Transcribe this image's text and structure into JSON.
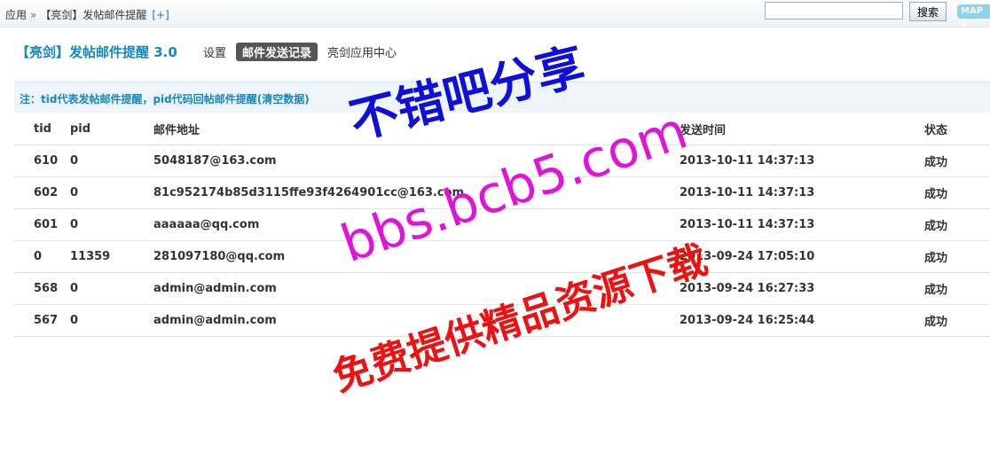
{
  "breadcrumb": {
    "app": "应用",
    "separator": "»",
    "plugin": "【亮剑】发帖邮件提醒",
    "add": "[+]"
  },
  "search": {
    "value": "",
    "button": "搜索"
  },
  "map_button": "MAP",
  "header": {
    "title": "【亮剑】发帖邮件提醒 3.0",
    "tabs": [
      {
        "label": "设置",
        "active": false
      },
      {
        "label": "邮件发送记录",
        "active": true
      },
      {
        "label": "亮剑应用中心",
        "active": false
      }
    ]
  },
  "note": "注：tid代表发帖邮件提醒，pid代码回帖邮件提醒(清空数据)",
  "table": {
    "columns": [
      "tid",
      "pid",
      "邮件地址",
      "发送时间",
      "状态"
    ],
    "rows": [
      [
        "610",
        "0",
        "5048187@163.com",
        "2013-10-11 14:37:13",
        "成功"
      ],
      [
        "602",
        "0",
        "81c952174b85d3115ffe93f4264901cc@163.com",
        "2013-10-11 14:37:13",
        "成功"
      ],
      [
        "601",
        "0",
        "aaaaaa@qq.com",
        "2013-10-11 14:37:13",
        "成功"
      ],
      [
        "0",
        "11359",
        "281097180@qq.com",
        "2013-09-24 17:05:10",
        "成功"
      ],
      [
        "568",
        "0",
        "admin@admin.com",
        "2013-09-24 16:27:33",
        "成功"
      ],
      [
        "567",
        "0",
        "admin@admin.com",
        "2013-09-24 16:25:44",
        "成功"
      ]
    ]
  },
  "watermark": {
    "line1": "不错吧分享",
    "line2": "bbs.bcb5.com",
    "line3": "免费提供精品资源下载"
  }
}
